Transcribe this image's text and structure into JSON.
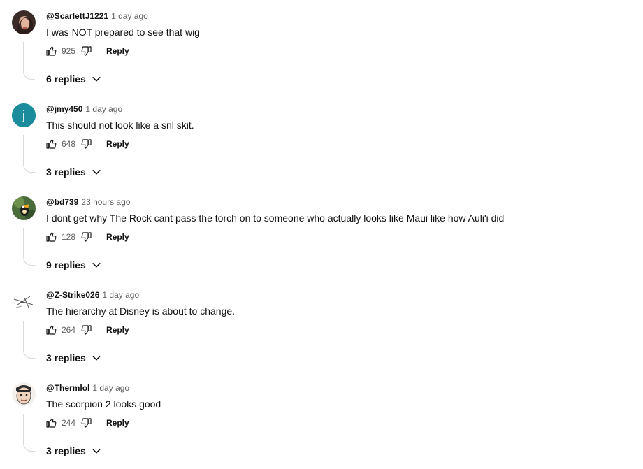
{
  "comments": [
    {
      "author": "@ScarlettJ1221",
      "time": "1 day ago",
      "text": "I was NOT prepared to see that wig",
      "likes": "925",
      "reply_label": "Reply",
      "replies_label": "6 replies",
      "avatar_icon": "user-photo-avatar"
    },
    {
      "author": "@jmy450",
      "time": "1 day ago",
      "text": "This should not look like a snl skit.",
      "likes": "648",
      "reply_label": "Reply",
      "replies_label": "3 replies",
      "avatar_letter": "j",
      "avatar_color": "#1a8c9c"
    },
    {
      "author": "@bd739",
      "time": "23 hours ago",
      "text": "I dont get why The Rock cant pass the torch on to someone who actually looks like Maui like how Auli'i did",
      "likes": "128",
      "reply_label": "Reply",
      "replies_label": "9 replies",
      "avatar_icon": "toucan-avatar"
    },
    {
      "author": "@Z-Strike026",
      "time": "1 day ago",
      "text": "The hierarchy at Disney is about to change.",
      "likes": "264",
      "reply_label": "Reply",
      "replies_label": "3 replies",
      "avatar_icon": "sketch-avatar"
    },
    {
      "author": "@Thermlol",
      "time": "1 day ago",
      "text": "The scorpion 2 looks good",
      "likes": "244",
      "reply_label": "Reply",
      "replies_label": "3 replies",
      "avatar_icon": "cartoon-face-avatar"
    }
  ]
}
